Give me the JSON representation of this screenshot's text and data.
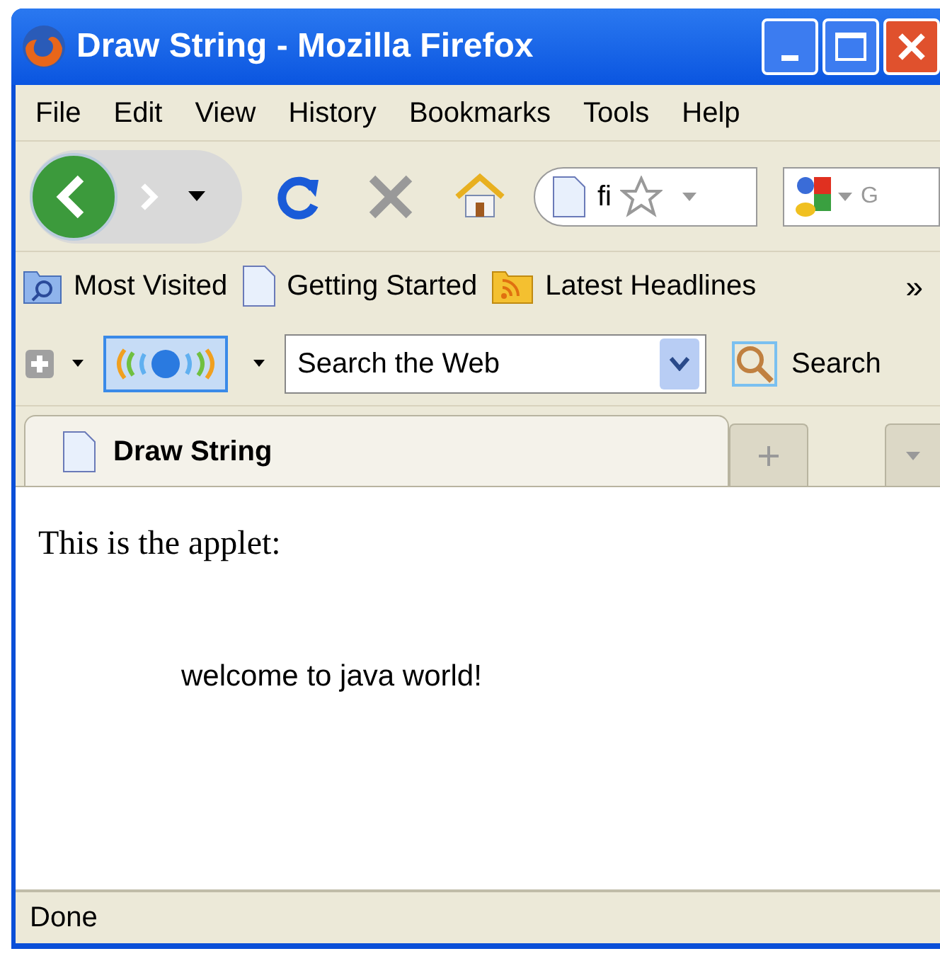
{
  "window": {
    "title": "Draw String - Mozilla Firefox"
  },
  "menu": [
    "File",
    "Edit",
    "View",
    "History",
    "Bookmarks",
    "Tools",
    "Help"
  ],
  "navigation": {
    "url": "fi",
    "search_placeholder": "G"
  },
  "bookmarks": [
    "Most Visited",
    "Getting Started",
    "Latest Headlines"
  ],
  "bookmarks_overflow": "»",
  "toolbar": {
    "radio_active": true,
    "search_placeholder": "Search the Web",
    "search_button": "Search"
  },
  "tabs": [
    {
      "label": "Draw String",
      "selected": true
    }
  ],
  "content": {
    "text": "This is the applet:",
    "applet_text": "welcome to java world!"
  },
  "status_bar": {
    "text": "Done"
  }
}
